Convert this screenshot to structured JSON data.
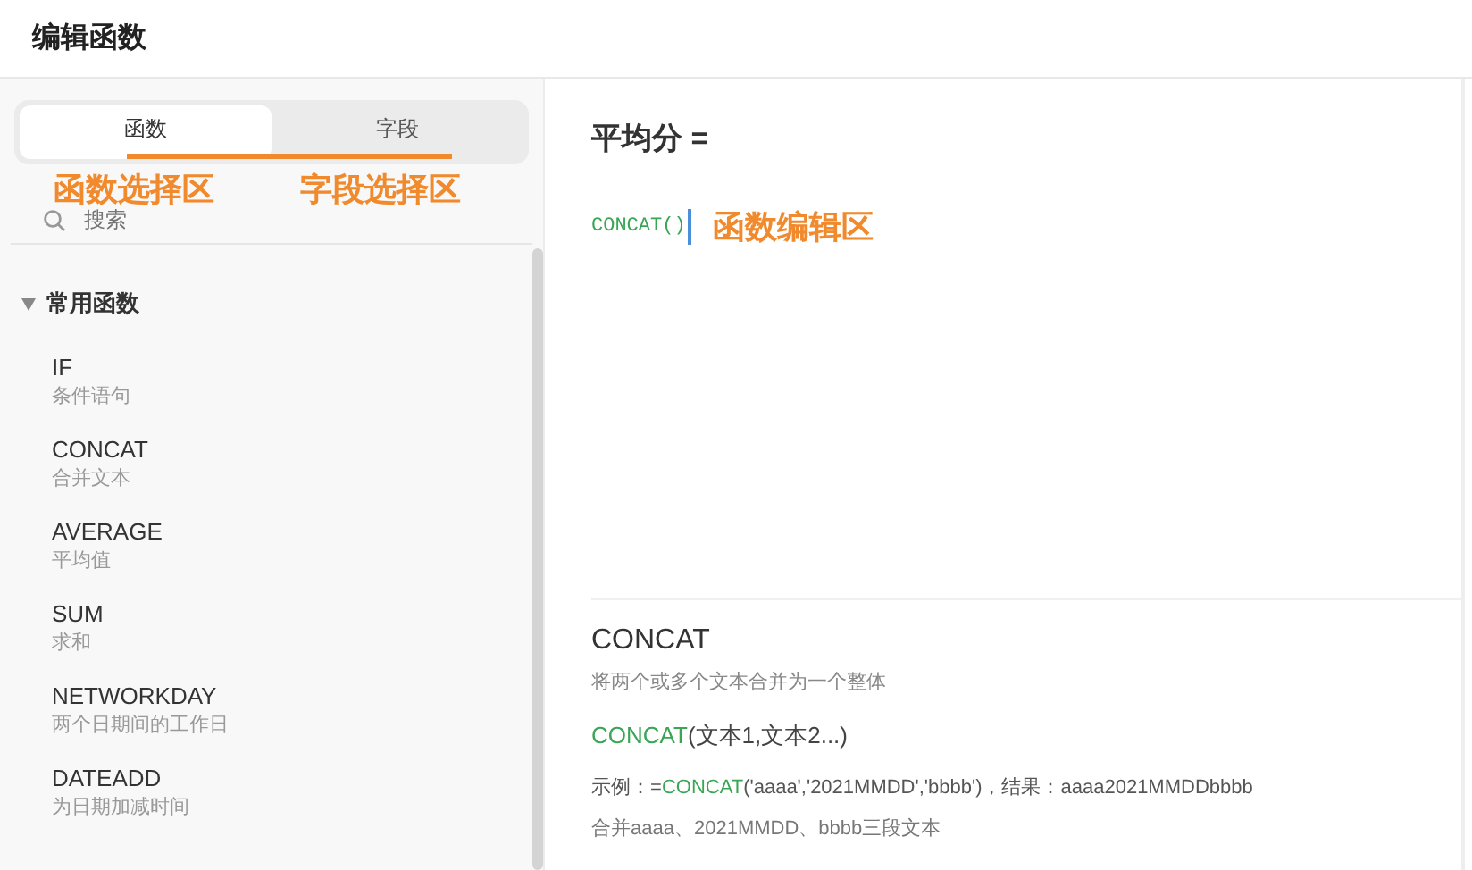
{
  "window": {
    "title": "编辑函数"
  },
  "tabs": [
    {
      "label": "函数",
      "selected": true
    },
    {
      "label": "字段",
      "selected": false
    }
  ],
  "annotations": {
    "functions_area": "函数选择区",
    "fields_area": "字段选择区",
    "editor_area": "函数编辑区"
  },
  "search": {
    "placeholder": "搜索"
  },
  "function_groups": [
    {
      "label": "常用函数",
      "expanded": true,
      "children": [
        {
          "name": "IF",
          "description": "条件语句"
        },
        {
          "name": "CONCAT",
          "description": "合并文本"
        },
        {
          "name": "AVERAGE",
          "description": "平均值"
        },
        {
          "name": "SUM",
          "description": "求和"
        },
        {
          "name": "NETWORKDAY",
          "description": "两个日期间的工作日"
        },
        {
          "name": "DATEADD",
          "description": "为日期加减时间"
        }
      ]
    }
  ],
  "editor": {
    "field_label": "平均分 =",
    "formula": "CONCAT()"
  },
  "help": {
    "name": "CONCAT",
    "description": "将两个或多个文本合并为一个整体",
    "syntax": {
      "func": "CONCAT",
      "args": "(文本1,文本2...)"
    },
    "example": {
      "prefix": "示例：=",
      "func": "CONCAT",
      "rest": "('aaaa','2021MMDD','bbbb')，结果：aaaa2021MMDDbbbb"
    },
    "note": "合并aaaa、2021MMDD、bbbb三段文本"
  }
}
